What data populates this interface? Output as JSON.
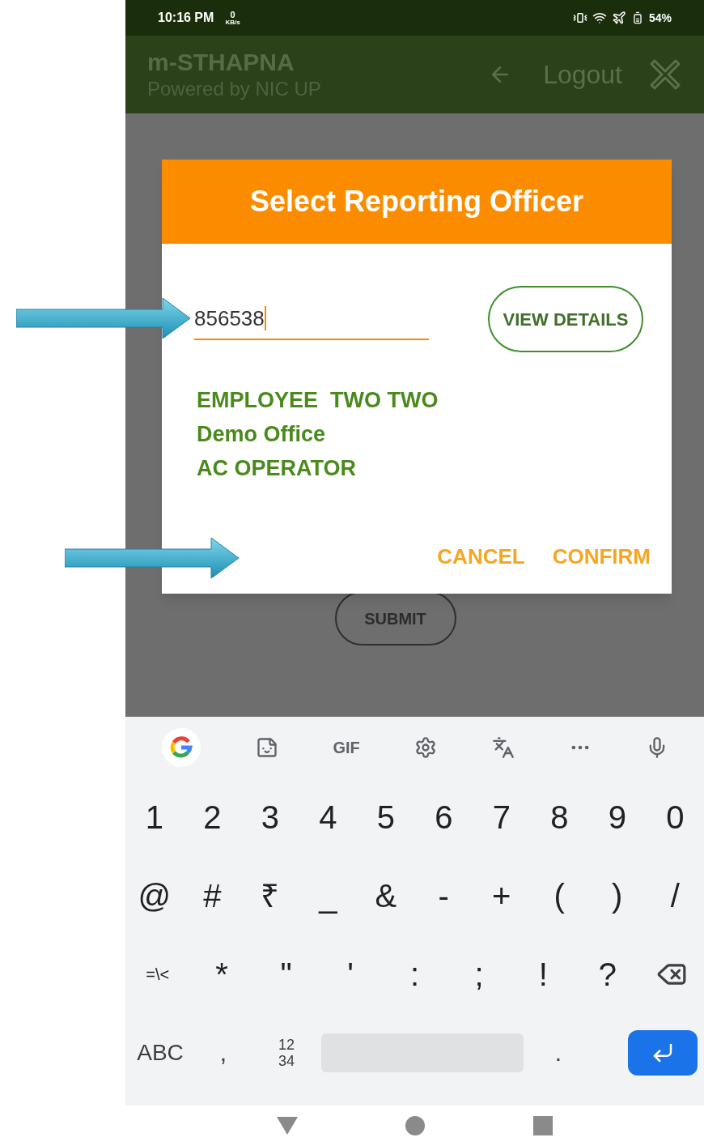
{
  "status_bar": {
    "time": "10:16 PM",
    "speed_value": "0",
    "speed_unit": "KB/s",
    "battery": "54%"
  },
  "app_bar": {
    "title": "m-STHAPNA",
    "subtitle": "Powered by NIC UP",
    "logout": "Logout"
  },
  "background": {
    "submit_button": "SUBMIT"
  },
  "dialog": {
    "title": "Select Reporting Officer",
    "field": {
      "value": "856538"
    },
    "view_details_button": "VIEW DETAILS",
    "details": [
      "EMPLOYEE  TWO TWO",
      "Demo Office",
      "AC OPERATOR"
    ],
    "buttons": [
      "CANCEL",
      "CONFIRM"
    ]
  },
  "keyboard": {
    "toolbar_gif": "GIF",
    "rows": [
      [
        "1",
        "2",
        "3",
        "4",
        "5",
        "6",
        "7",
        "8",
        "9",
        "0"
      ],
      [
        "@",
        "#",
        "₹",
        "_",
        "&",
        "-",
        "+",
        "(",
        ")",
        "/"
      ],
      [
        "=\\<",
        "*",
        "\"",
        "'",
        ":",
        ";",
        "!",
        "?"
      ]
    ],
    "bottom_row": [
      {
        "kind": "text",
        "label": "ABC"
      },
      {
        "kind": "text",
        "label": ","
      },
      {
        "kind": "stack",
        "lines": [
          "12",
          "34"
        ]
      },
      {
        "kind": "space"
      },
      {
        "kind": "text",
        "label": "."
      },
      {
        "kind": "enter"
      }
    ]
  }
}
